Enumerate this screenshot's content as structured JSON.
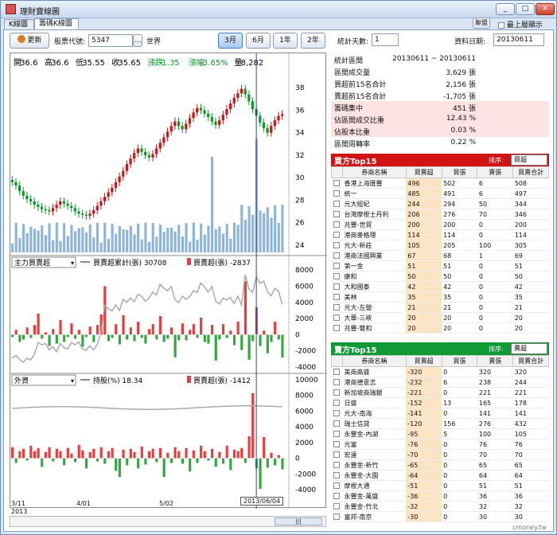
{
  "window": {
    "title": "理財寶線圖",
    "controls": [
      "_",
      "□",
      "✕"
    ]
  },
  "tabs": [
    {
      "label": "K線圖"
    },
    {
      "label": "籌碼K線圖"
    }
  ],
  "toolbar": {
    "update_label": "更新",
    "stock_label": "股票代號:",
    "stock_code": "5347",
    "stock_name": "世界",
    "ranges": [
      "3月",
      "6月",
      "1年",
      "2年"
    ],
    "selected_range": "3月"
  },
  "topright": {
    "link_label": "聯盟",
    "checkbox_label": "最上層顯示"
  },
  "stats_controls": {
    "days_label": "統計天數:",
    "days_value": "1",
    "date_label": "資料日期:",
    "date_value": "20130611"
  },
  "stats": [
    {
      "k": "統計區間",
      "v": "20130611 ~ 20130611",
      "pink": false
    },
    {
      "k": "區間成交量",
      "v": "3,629 張",
      "pink": false
    },
    {
      "k": "買超前15名合計",
      "v": "2,156 張",
      "pink": false
    },
    {
      "k": "賣超前15名合計",
      "v": "-1,705 張",
      "pink": false
    },
    {
      "k": "籌碼集中",
      "v": "451 張",
      "pink": true
    },
    {
      "k": "佔區間成交比重",
      "v": "12.43 %",
      "pink": true
    },
    {
      "k": "佔股本比重",
      "v": "0.03 %",
      "pink": true
    },
    {
      "k": "區間周轉率",
      "v": "0.22 %",
      "pink": false
    }
  ],
  "ohlc": {
    "open_l": "開",
    "open": "36.6",
    "high_l": "高",
    "high": "36.6",
    "low_l": "低",
    "low": "35.55",
    "close_l": "收",
    "close": "35.65",
    "chg_l": "漲跌",
    "chg": "-1.35",
    "pct_l": "漲幅",
    "pct": "-3.65%",
    "vol_l": "量",
    "vol": "8,282"
  },
  "panel2": {
    "select": "主力買賣超",
    "legend1": "買賣超累計(張) 30708",
    "legend2": "買賣超(張) -2837"
  },
  "panel3": {
    "select": "外資",
    "legend1": "持股(%) 18.34",
    "legend2": "買賣超(張) -1412"
  },
  "axis": {
    "p1": [
      "38",
      "36",
      "34",
      "32",
      "30",
      "28",
      "26",
      "24"
    ],
    "p2": [
      "8000",
      "6000",
      "4000",
      "2000",
      "0",
      "-2000",
      "-4000"
    ],
    "p3": [
      "10000",
      "8000",
      "6000",
      "4000",
      "2000",
      "0",
      "-2000",
      "-4000"
    ],
    "x": [
      "3/11",
      "4/01",
      "5/02"
    ],
    "year": "2013",
    "cursor_date": "2013/06/04"
  },
  "buy": {
    "title": "買方Top15",
    "sort_label": "排序:",
    "sort": "買超",
    "headers": [
      "券商名稱",
      "買賣超",
      "買張",
      "賣張",
      "買賣合計"
    ],
    "rows": [
      [
        "香港上海匯豐",
        "496",
        "502",
        "6",
        "508"
      ],
      [
        "統一",
        "485",
        "491",
        "6",
        "497"
      ],
      [
        "元大經紀",
        "244",
        "294",
        "50",
        "344"
      ],
      [
        "台灣摩根士丹利",
        "206",
        "276",
        "70",
        "346"
      ],
      [
        "兆豐-世貿",
        "200",
        "200",
        "0",
        "200"
      ],
      [
        "港商麥格理",
        "114",
        "114",
        "0",
        "114"
      ],
      [
        "元大-新莊",
        "105",
        "205",
        "100",
        "305"
      ],
      [
        "港商法國興業",
        "67",
        "68",
        "1",
        "69"
      ],
      [
        "第一金",
        "51",
        "51",
        "0",
        "51"
      ],
      [
        "康和",
        "50",
        "50",
        "0",
        "50"
      ],
      [
        "大和國泰",
        "42",
        "42",
        "0",
        "42"
      ],
      [
        "美林",
        "35",
        "35",
        "0",
        "35"
      ],
      [
        "元大-左營",
        "21",
        "21",
        "0",
        "21"
      ],
      [
        "大華-三峽",
        "20",
        "20",
        "0",
        "20"
      ],
      [
        "兆豐-雙和",
        "20",
        "20",
        "0",
        "20"
      ]
    ]
  },
  "sell": {
    "title": "賣方Top15",
    "sort_label": "排序:",
    "sort": "賣超",
    "headers": [
      "券商名稱",
      "買賣超",
      "買張",
      "賣張",
      "買賣合計"
    ],
    "rows": [
      [
        "美商高盛",
        "-320",
        "0",
        "320",
        "320"
      ],
      [
        "港商德意志",
        "-232",
        "6",
        "238",
        "244"
      ],
      [
        "新加坡商瑞銀",
        "-221",
        "0",
        "221",
        "221"
      ],
      [
        "日盛",
        "-152",
        "13",
        "165",
        "178"
      ],
      [
        "元大-南海",
        "-141",
        "0",
        "141",
        "141"
      ],
      [
        "瑞士信貸",
        "-120",
        "156",
        "276",
        "432"
      ],
      [
        "永豐金-內湖",
        "-95",
        "5",
        "100",
        "105"
      ],
      [
        "元富",
        "-76",
        "0",
        "76",
        "76"
      ],
      [
        "宏遠",
        "-70",
        "0",
        "70",
        "70"
      ],
      [
        "永豐金-新竹",
        "-65",
        "0",
        "65",
        "65"
      ],
      [
        "永豐金-大園",
        "-64",
        "0",
        "64",
        "64"
      ],
      [
        "摩根大通",
        "-51",
        "0",
        "51",
        "51"
      ],
      [
        "永豐金-萬盛",
        "-36",
        "0",
        "36",
        "36"
      ],
      [
        "永豐金-竹北",
        "-32",
        "0",
        "32",
        "32"
      ],
      [
        "富邦-南京",
        "-30",
        "0",
        "30",
        "30"
      ]
    ]
  },
  "footer": {
    "watermark": "cmoney.tw",
    "scroll": "|||"
  },
  "chart_data": [
    {
      "type": "candlestick",
      "title": "",
      "ylim": [
        23.5,
        39.5
      ],
      "close": [
        29.6,
        29.3,
        28.8,
        28.4,
        28.1,
        27.9,
        27.6,
        27.4,
        27.2,
        27.1,
        27.0,
        27.3,
        27.6,
        27.9,
        27.7,
        27.5,
        27.3,
        27.0,
        26.8,
        26.7,
        26.6,
        26.8,
        27.1,
        27.5,
        27.9,
        28.3,
        28.7,
        29.1,
        29.6,
        30.1,
        30.6,
        31.2,
        31.7,
        32.2,
        32.6,
        32.3,
        32.0,
        31.8,
        32.1,
        32.6,
        33.1,
        33.6,
        34.1,
        34.6,
        35.0,
        34.6,
        34.3,
        34.8,
        35.3,
        35.8,
        36.2,
        36.0,
        35.7,
        35.4,
        35.0,
        34.7,
        35.1,
        35.6,
        36.1,
        36.6,
        37.1,
        37.5,
        37.9,
        37.4,
        36.8,
        36.1,
        35.5,
        34.9,
        34.4,
        34.0,
        34.6,
        35.1,
        35.5,
        35.65
      ]
    },
    {
      "type": "bar",
      "title": "",
      "ylim": [
        -4000,
        9000
      ],
      "series": [
        {
          "values": [
            -300,
            600,
            -900,
            -600,
            900,
            -400,
            1200,
            2600,
            -500,
            300,
            -1400,
            700,
            -1100,
            1800,
            -900,
            -300,
            1400,
            -500,
            600,
            -1500,
            -300,
            1000,
            -900,
            1200,
            2500,
            6000,
            -800,
            -400,
            1300,
            -1200,
            2400,
            -600,
            900,
            -800,
            1600,
            -400,
            -1100,
            700,
            1300,
            -600,
            2300,
            -900,
            -500,
            900,
            -2800,
            -700,
            1400,
            -700,
            600,
            1300,
            -400,
            2100,
            -900,
            -1100,
            1200,
            -3200,
            -600,
            1300,
            -400,
            500,
            -1300,
            1600,
            -1900,
            6600,
            -3100,
            -800,
            3400,
            -1400,
            500,
            -2300,
            -900,
            1600,
            -600,
            -2837
          ]
        }
      ]
    },
    {
      "type": "bar",
      "title": "",
      "ylim": [
        -4000,
        10000
      ],
      "series": [
        {
          "values": [
            1400,
            -600,
            900,
            1200,
            -300,
            1600,
            900,
            1300,
            -1100,
            800,
            1400,
            -400,
            1200,
            900,
            -900,
            1300,
            600,
            -500,
            1700,
            1000,
            -1300,
            800,
            1200,
            -400,
            1400,
            -700,
            900,
            1300,
            -1600,
            -2400,
            1100,
            -900,
            1200,
            800,
            -1300,
            1500,
            -800,
            900,
            1200,
            -500,
            1300,
            -2400,
            700,
            -600,
            1400,
            900,
            -700,
            1300,
            -1700,
            1000,
            -600,
            1600,
            900,
            -300,
            1200,
            -1100,
            800,
            -700,
            1600,
            -1500,
            1100,
            900,
            1300,
            -600,
            2800,
            8300,
            -1300,
            -3900,
            2700,
            -1200,
            700,
            -900,
            400,
            -1412
          ]
        }
      ]
    }
  ]
}
